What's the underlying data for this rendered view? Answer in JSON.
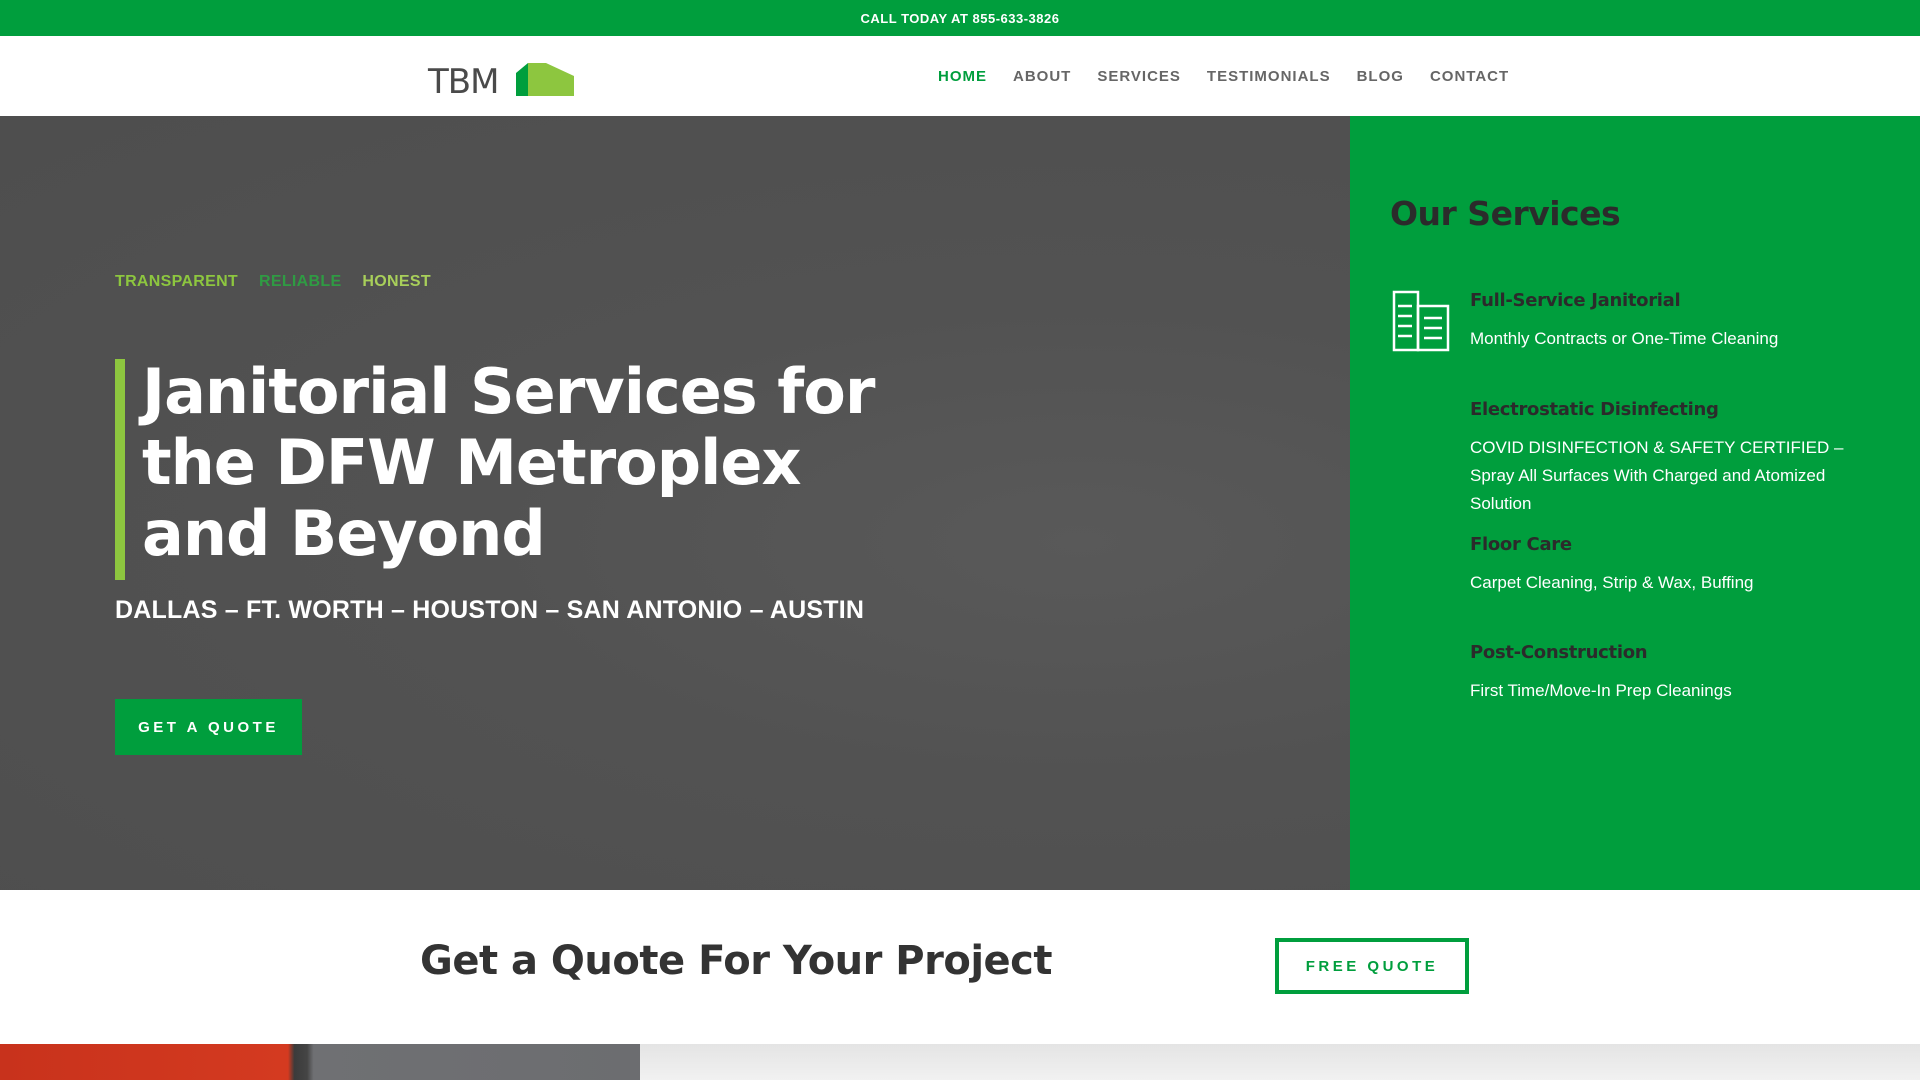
{
  "topbar": {
    "text": "CALL TODAY AT 855-633-3826"
  },
  "logo": {
    "text": "TBM"
  },
  "nav": {
    "items": [
      {
        "label": "HOME",
        "active": true
      },
      {
        "label": "ABOUT"
      },
      {
        "label": "SERVICES"
      },
      {
        "label": "TESTIMONIALS"
      },
      {
        "label": "BLOG"
      },
      {
        "label": "CONTACT"
      }
    ]
  },
  "hero": {
    "taglines": [
      "TRANSPARENT",
      "RELIABLE",
      "HONEST"
    ],
    "title": "Janitorial Services for the DFW Metroplex and Beyond",
    "cities": "DALLAS – FT. WORTH – HOUSTON – SAN ANTONIO – AUSTIN",
    "cta": "GET A QUOTE"
  },
  "services": {
    "heading": "Our Services",
    "items": [
      {
        "title": "Full-Service Janitorial",
        "desc": "Monthly Contracts or One-Time Cleaning",
        "icon": "building-icon"
      },
      {
        "title": "Electrostatic Disinfecting",
        "desc": "COVID DISINFECTION & SAFETY CERTIFIED – Spray All Surfaces With Charged and Atomized Solution"
      },
      {
        "title": "Floor Care",
        "desc": "Carpet Cleaning, Strip & Wax, Buffing"
      },
      {
        "title": "Post-Construction",
        "desc": "First Time/Move-In Prep Cleanings"
      }
    ]
  },
  "quote_band": {
    "title": "Get a Quote For Your Project",
    "button": "FREE QUOTE"
  },
  "colors": {
    "brand_green": "#009e3d",
    "accent_lime": "#8dc63f",
    "hero_gray": "#525252"
  }
}
